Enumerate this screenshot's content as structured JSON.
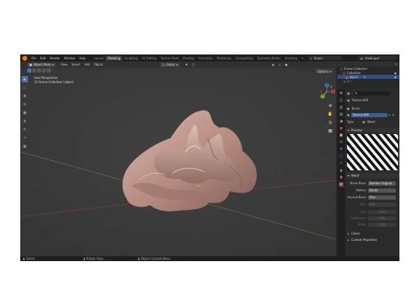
{
  "topbar": {
    "menus": [
      "File",
      "Edit",
      "Render",
      "Window",
      "Help"
    ],
    "workspaces": [
      "Layout",
      "Modeling",
      "Sculpting",
      "UV Editing",
      "Texture Paint",
      "Shading",
      "Animation",
      "Rendering",
      "Compositing",
      "Geometry Nodes",
      "Scripting"
    ],
    "active_workspace_index": 1,
    "add_tab": "+",
    "scene_label": "Scene",
    "viewlayer_label": "ViewLayer"
  },
  "viewport": {
    "mode": "Object Mode",
    "menus": [
      "View",
      "Select",
      "Add",
      "Object"
    ],
    "orientation": "Global",
    "options": "Options",
    "perspective_title": "User Perspective",
    "perspective_sub": "(1) Scene Collection | object",
    "tools": [
      "▸",
      "◌",
      "✥",
      "↻",
      "▣",
      "⊕",
      "✎",
      "↗",
      "▦"
    ],
    "nav_icons": [
      "⊕",
      "✋",
      "◎",
      "▦"
    ],
    "axes": {
      "x": "X",
      "y": "Y",
      "z": "Z"
    },
    "colors": {
      "x": "#e5324b",
      "y": "#7dbf2e",
      "z": "#3d7ee6"
    }
  },
  "status": {
    "items": [
      "Select",
      "Rotate View",
      "Object Context Menu"
    ]
  },
  "outliner": {
    "title": "Scene Collection",
    "collection": "Collection",
    "object": "object",
    "world": "Bill"
  },
  "properties": {
    "texture_dropdown": "Texture.006",
    "brush_label": "Brush",
    "texture_field": "Texture.006",
    "type_label": "Type",
    "type_value": "Wood",
    "preview_label": "Preview",
    "wood_section": "Wood",
    "noise_basis_label": "Noise Basis",
    "noise_basis_value": "Blender Original",
    "pattern_label": "Pattern",
    "pattern_value": "Bands",
    "second_basis_label": "Second Basis",
    "second_basis_value": "Sine",
    "type2_label": "Type",
    "type2_value": "Soft",
    "size_label": "Size",
    "size_value": "0.25",
    "turbulence_label": "Turbulence",
    "turbulence_value": "5.00",
    "nabla_label": "Nabla",
    "nabla_value": "0.03",
    "colors_section": "Colors",
    "custom_props_section": "Custom Properties"
  }
}
